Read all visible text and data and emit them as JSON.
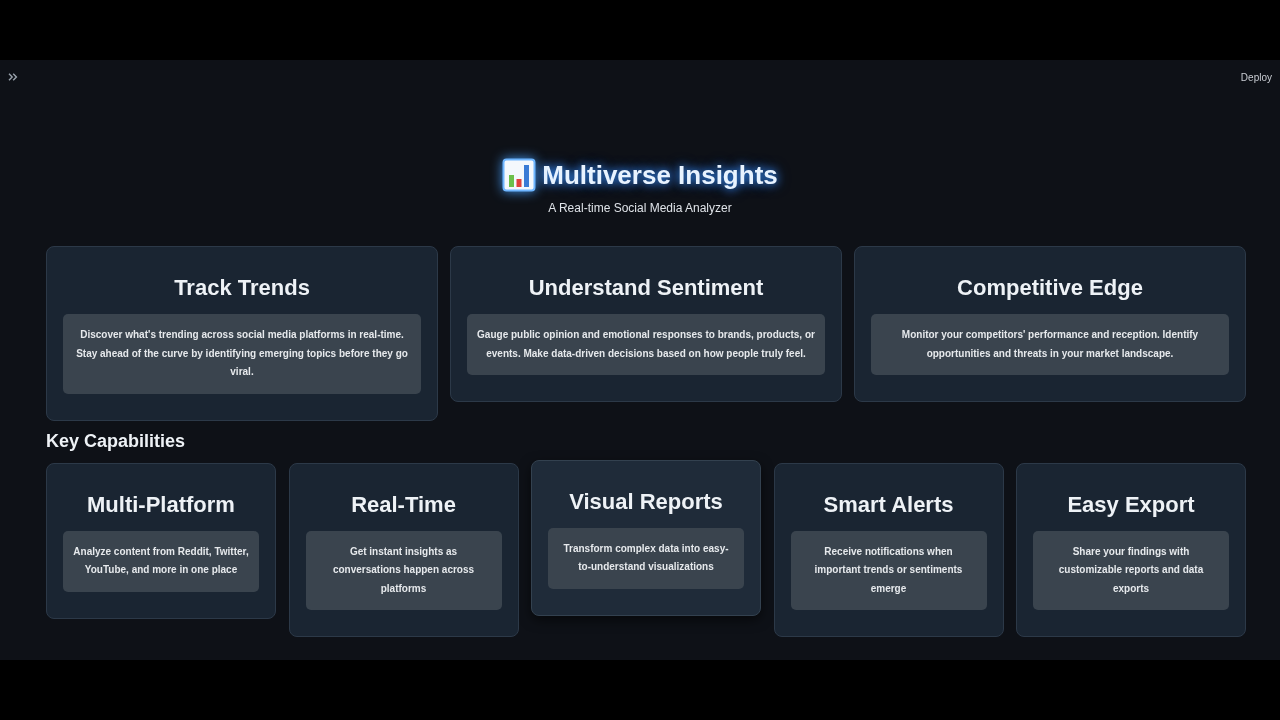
{
  "top_bar": {
    "deploy_label": "Deploy"
  },
  "header": {
    "title": "Multiverse Insights",
    "subtitle": "A Real-time Social Media Analyzer"
  },
  "features": [
    {
      "title": "Track Trends",
      "description": "Discover what's trending across social media platforms in real-time. Stay ahead of the curve by identifying emerging topics before they go viral."
    },
    {
      "title": "Understand Sentiment",
      "description": "Gauge public opinion and emotional responses to brands, products, or events. Make data-driven decisions based on how people truly feel."
    },
    {
      "title": "Competitive Edge",
      "description": "Monitor your competitors' performance and reception. Identify opportunities and threats in your market landscape."
    }
  ],
  "capabilities_heading": "Key Capabilities",
  "capabilities": [
    {
      "title": "Multi-Platform",
      "description": "Analyze content from Reddit, Twitter, YouTube, and more in one place",
      "hovered": false
    },
    {
      "title": "Real-Time",
      "description": "Get instant insights as conversations happen across platforms",
      "hovered": false
    },
    {
      "title": "Visual Reports",
      "description": "Transform complex data into easy-to-understand visualizations",
      "hovered": true
    },
    {
      "title": "Smart Alerts",
      "description": "Receive notifications when important trends or sentiments emerge",
      "hovered": false
    },
    {
      "title": "Easy Export",
      "description": "Share your findings with customizable reports and data exports",
      "hovered": false
    }
  ]
}
